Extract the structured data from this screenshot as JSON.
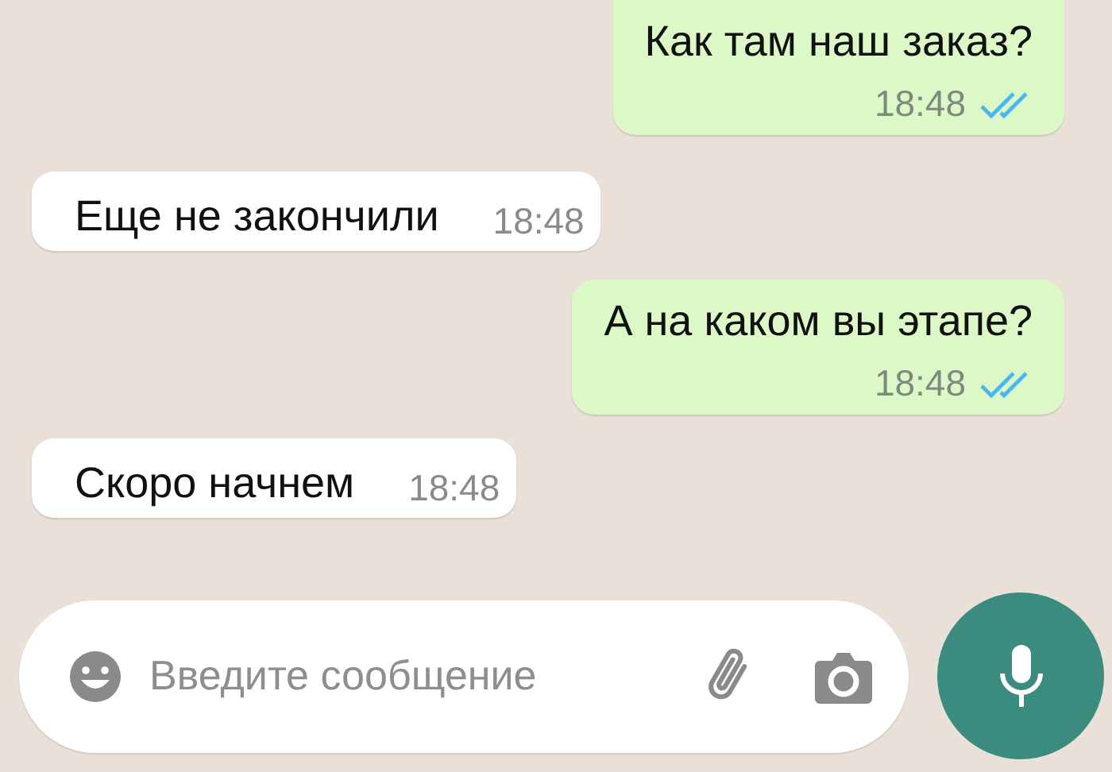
{
  "messages": [
    {
      "kind": "outgoing",
      "text": "Как там наш заказ?",
      "time": "18:48",
      "read": true
    },
    {
      "kind": "incoming",
      "text": "Еще не закончили",
      "time": "18:48"
    },
    {
      "kind": "outgoing",
      "text": "А на каком вы этапе?",
      "time": "18:48",
      "read": true
    },
    {
      "kind": "incoming",
      "text": "Скоро начнем",
      "time": "18:48"
    }
  ],
  "composer": {
    "placeholder": "Введите сообщение"
  }
}
